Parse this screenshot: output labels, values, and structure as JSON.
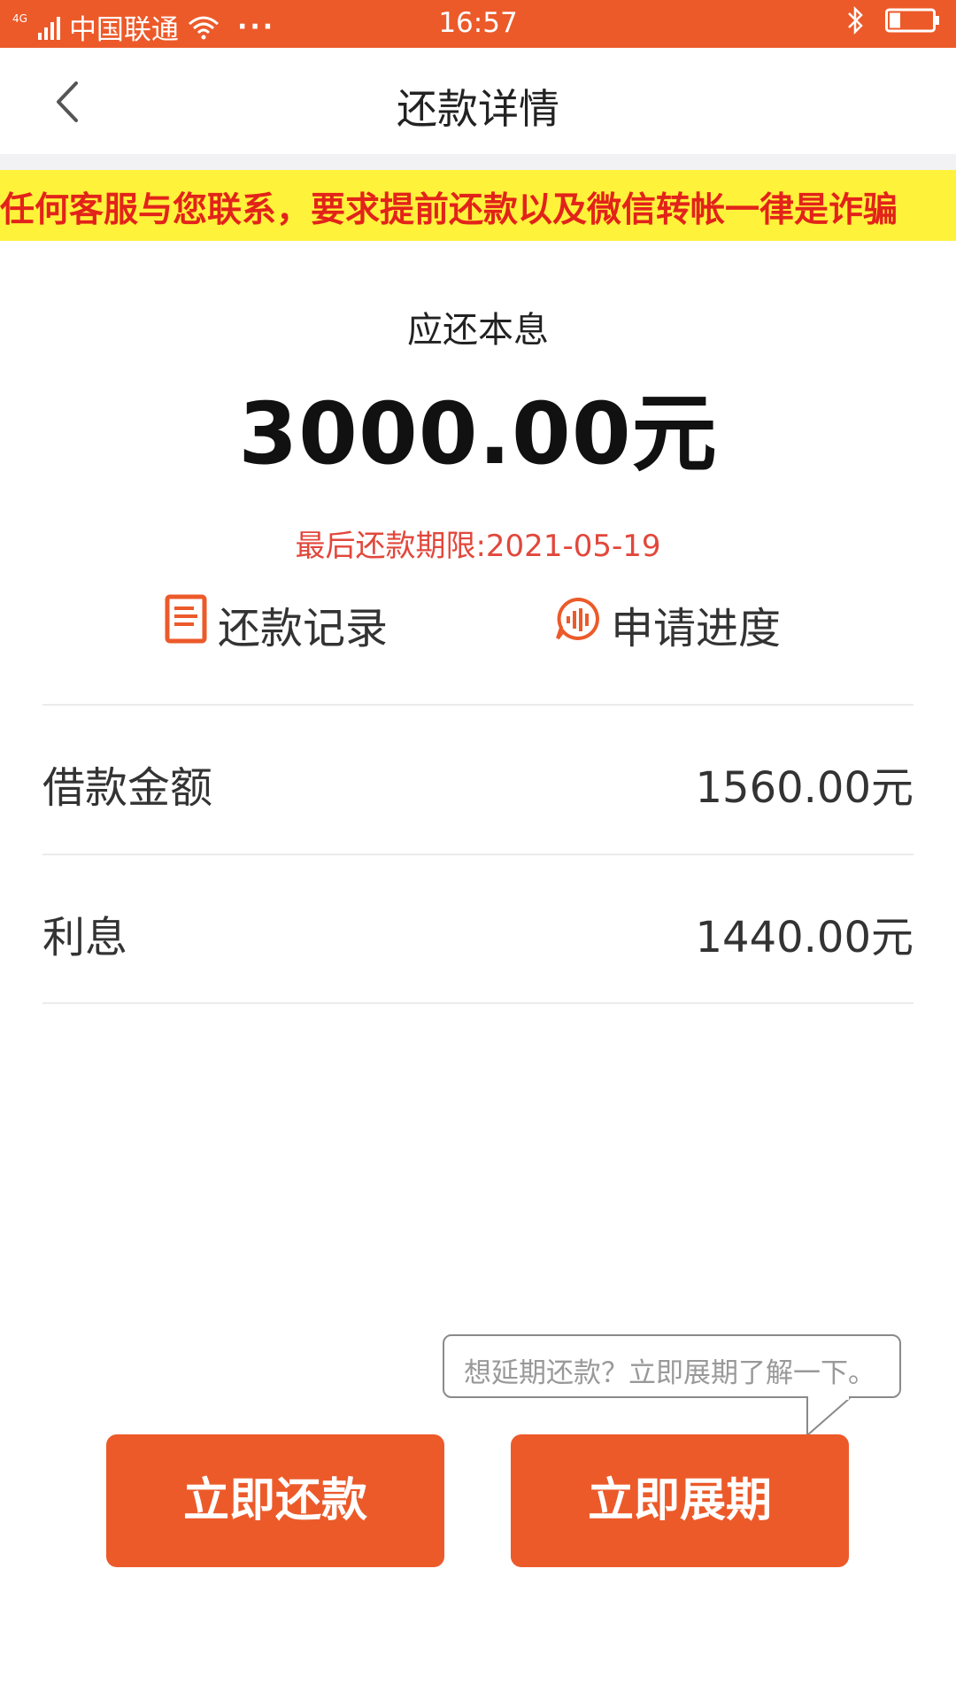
{
  "status_bar": {
    "network": "4G",
    "carrier": "中国联通",
    "more": "···",
    "time": "16:57"
  },
  "nav": {
    "title": "还款详情"
  },
  "notice": {
    "text": "任何客服与您联系，要求提前还款以及微信转帐一律是诈骗"
  },
  "summary": {
    "label": "应还本息",
    "amount": "3000.00元",
    "deadline": "最后还款期限:2021-05-19"
  },
  "actions": {
    "record_label": "还款记录",
    "progress_label": "申请进度"
  },
  "details": [
    {
      "label": "借款金额",
      "value": "1560.00元"
    },
    {
      "label": "利息",
      "value": "1440.00元"
    }
  ],
  "tooltip": {
    "text": "想延期还款？立即展期了解一下。"
  },
  "buttons": {
    "repay": "立即还款",
    "extend": "立即展期"
  },
  "colors": {
    "accent": "#EC5A2A",
    "notice_bg": "#FFF23A",
    "notice_text": "#E2231A",
    "deadline": "#E2473B"
  },
  "icons": {
    "back": "chevron-left-icon",
    "record": "document-icon",
    "progress": "speech-bubble-icon"
  }
}
